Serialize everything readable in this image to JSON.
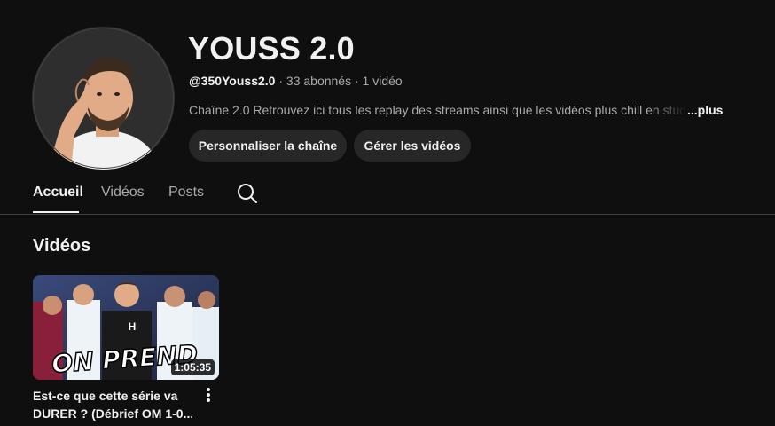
{
  "channel": {
    "name": "YOUSS 2.0",
    "handle": "@350Youss2.0",
    "separator": " · ",
    "subscribers": "33 abonnés",
    "video_count": "1 vidéo",
    "description": "Chaîne 2.0 Retrouvez ici tous les replay des streams ainsi que les vidéos plus chill en studio",
    "more_label": "...plus"
  },
  "buttons": {
    "customize": "Personnaliser la chaîne",
    "manage": "Gérer les vidéos"
  },
  "tabs": [
    {
      "label": "Accueil",
      "active": true
    },
    {
      "label": "Vidéos",
      "active": false
    },
    {
      "label": "Posts",
      "active": false
    }
  ],
  "section": {
    "title": "Vidéos"
  },
  "video": {
    "duration": "1:05:35",
    "title_line1": "Est-ce que cette série va",
    "title_line2": "DURER ? (Débrief OM 1-0...",
    "thumbnail_text": "ON PREND"
  },
  "colors": {
    "background": "#0f0f0f",
    "button": "#272727",
    "text_primary": "#f1f1f1",
    "text_secondary": "#aaaaaa"
  }
}
